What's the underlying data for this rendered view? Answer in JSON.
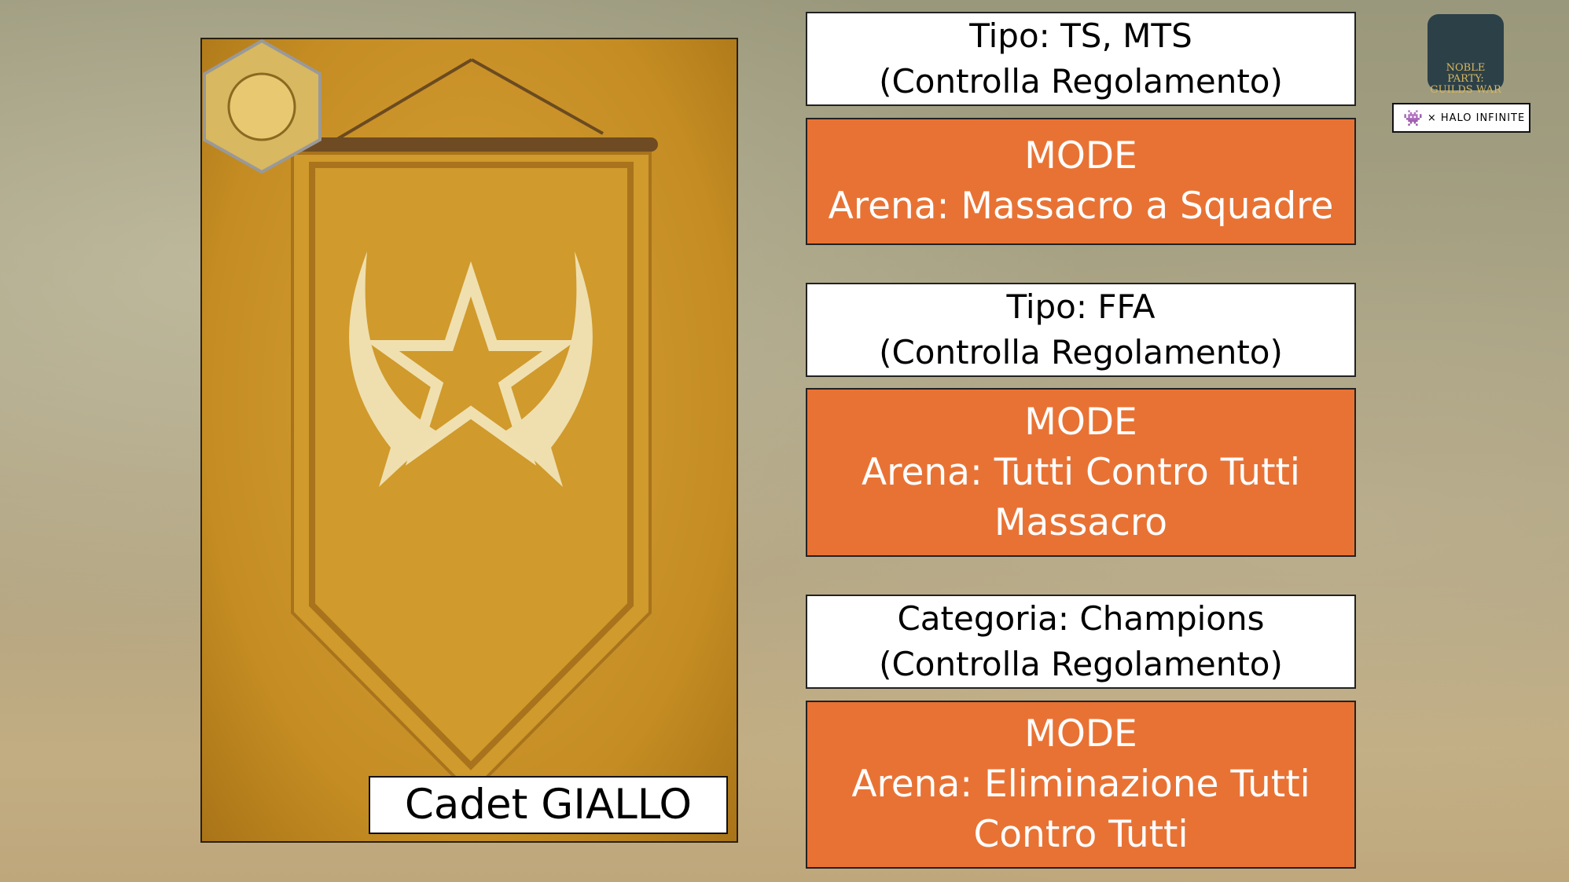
{
  "banner": {
    "label": "Cadet GIALLO"
  },
  "logo": {
    "text": "NOBLE PARTY: GUILDS WAR",
    "partner": "HALO INFINITE",
    "separator": "×"
  },
  "sections": [
    {
      "type_line": "Tipo: TS, MTS",
      "note": "(Controlla Regolamento)",
      "mode_title": "MODE",
      "mode_lines": [
        "Arena: Massacro a Squadre"
      ]
    },
    {
      "type_line": "Tipo: FFA",
      "note": "(Controlla Regolamento)",
      "mode_title": "MODE",
      "mode_lines": [
        "Arena: Tutti Contro Tutti",
        "Massacro"
      ]
    },
    {
      "type_line": "Categoria: Champions",
      "note": "(Controlla Regolamento)",
      "mode_title": "MODE",
      "mode_lines": [
        "Arena: Eliminazione Tutti",
        "Contro Tutti"
      ]
    }
  ],
  "colors": {
    "orange": "#e87234",
    "banner": "#c8901f"
  }
}
